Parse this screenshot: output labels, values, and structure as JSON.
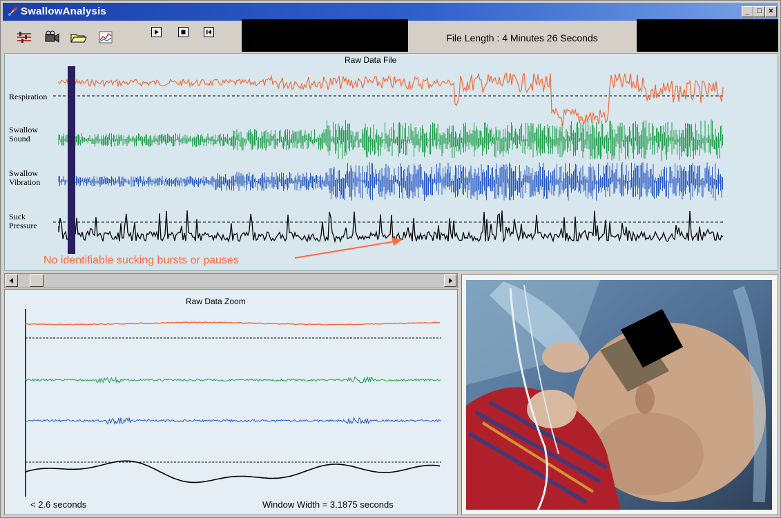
{
  "window": {
    "title": "SwallowAnalysis",
    "controls": [
      "_",
      "□",
      "×"
    ]
  },
  "toolbar": {
    "icons": [
      "settings-icon",
      "camera-icon",
      "open-folder-icon",
      "chart-icon"
    ],
    "playback": [
      "play-icon",
      "stop-icon",
      "rewind-icon"
    ],
    "file_length": "File Length :  4  Minutes  26  Seconds"
  },
  "raw_panel": {
    "title": "Raw Data File",
    "channels": [
      {
        "label": "Respiration",
        "color": "#f26b3a"
      },
      {
        "label": "Swallow Sound",
        "color": "#1e9e4a"
      },
      {
        "label": "Swallow Vibration",
        "color": "#2457c4"
      },
      {
        "label": "Suck Pressure",
        "color": "#000000"
      }
    ],
    "annotation": "No identifiable sucking bursts or pauses",
    "annotation_color": "#ff6a3a"
  },
  "zoom_panel": {
    "title": "Raw Data Zoom",
    "left_label": "< 2.6 seconds",
    "window_width": "Window Width = 3.1875 seconds"
  },
  "colors": {
    "respiration": "#f26b3a",
    "sound": "#1e9e4a",
    "vibration": "#2457c4",
    "pressure": "#000000",
    "cursor": "#2a1f5e",
    "titlebar": "#1c3fa8"
  }
}
